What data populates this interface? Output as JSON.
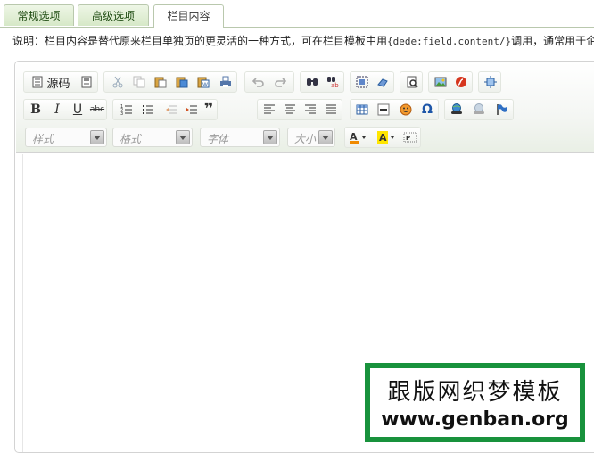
{
  "tabs": [
    {
      "label": "常规选项",
      "state": "normal"
    },
    {
      "label": "高级选项",
      "state": "normal"
    },
    {
      "label": "栏目内容",
      "state": "active"
    }
  ],
  "description": {
    "prefix": "说明：栏目内容是替代原来栏目单独页的更灵活的一种方式，可在栏目模板中用",
    "tag": "{dede:field.content/}",
    "suffix": "调用，通常用于企业"
  },
  "toolbar": {
    "source_label": "源码",
    "row1_icons": [
      "source-icon",
      "templates-icon",
      "cut-icon",
      "copy-icon",
      "paste-icon",
      "paste-text-icon",
      "paste-word-icon",
      "print-icon",
      "undo-icon",
      "redo-icon",
      "find-icon",
      "replace-icon",
      "select-all-icon",
      "remove-format-icon",
      "preview-icon",
      "image-icon",
      "flash-icon",
      "maximize-icon"
    ],
    "bold": "B",
    "italic": "I",
    "underline": "U",
    "strike": "abc",
    "quote": "❞",
    "special_char": "Ω",
    "styles_label": "样式",
    "format_label": "格式",
    "font_label": "字体",
    "size_label": "大小"
  },
  "colors": {
    "tab_green": "#d6e8c7",
    "watermark": "#18923c"
  },
  "watermark": {
    "line1": "跟版网织梦模板",
    "line2": "www.genban.org"
  }
}
